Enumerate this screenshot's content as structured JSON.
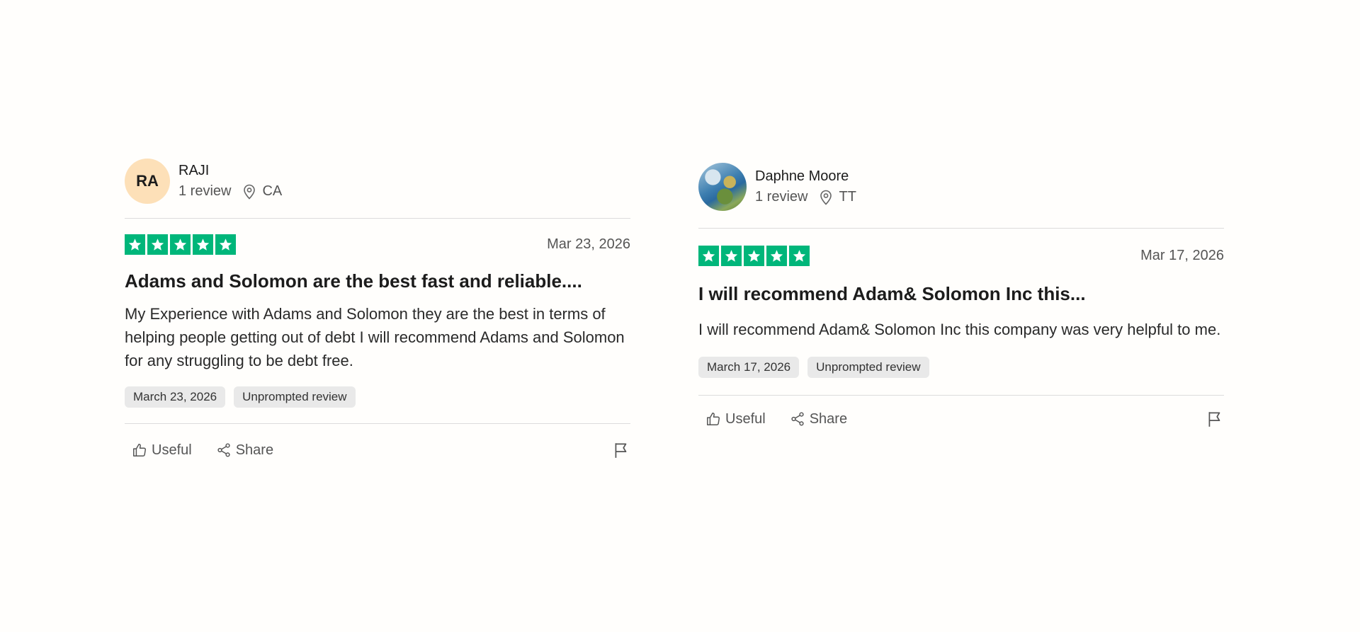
{
  "reviews": [
    {
      "avatar_initials": "RA",
      "avatar_color": "#fde0b8",
      "name": "RAJI",
      "review_count": "1 review",
      "location": "CA",
      "rating": 5,
      "date": "Mar 23, 2026",
      "title": "Adams and Solomon are the best fast and reliable....",
      "body": "My Experience with Adams and Solomon they are the best in terms of helping people getting out of debt I will recommend Adams and Solomon for any struggling to be debt free.",
      "experience_date": "March 23, 2026",
      "tag": "Unprompted review",
      "useful_label": "Useful",
      "share_label": "Share"
    },
    {
      "avatar_initials": "",
      "name": "Daphne Moore",
      "review_count": "1 review",
      "location": "TT",
      "rating": 5,
      "date": "Mar 17, 2026",
      "title": "I will recommend Adam& Solomon Inc this...",
      "body": "I will recommend Adam& Solomon Inc this company was very helpful to me.",
      "experience_date": "March 17, 2026",
      "tag": "Unprompted review",
      "useful_label": "Useful",
      "share_label": "Share"
    }
  ],
  "colors": {
    "star_green": "#00b67a",
    "background": "#fffefc"
  }
}
